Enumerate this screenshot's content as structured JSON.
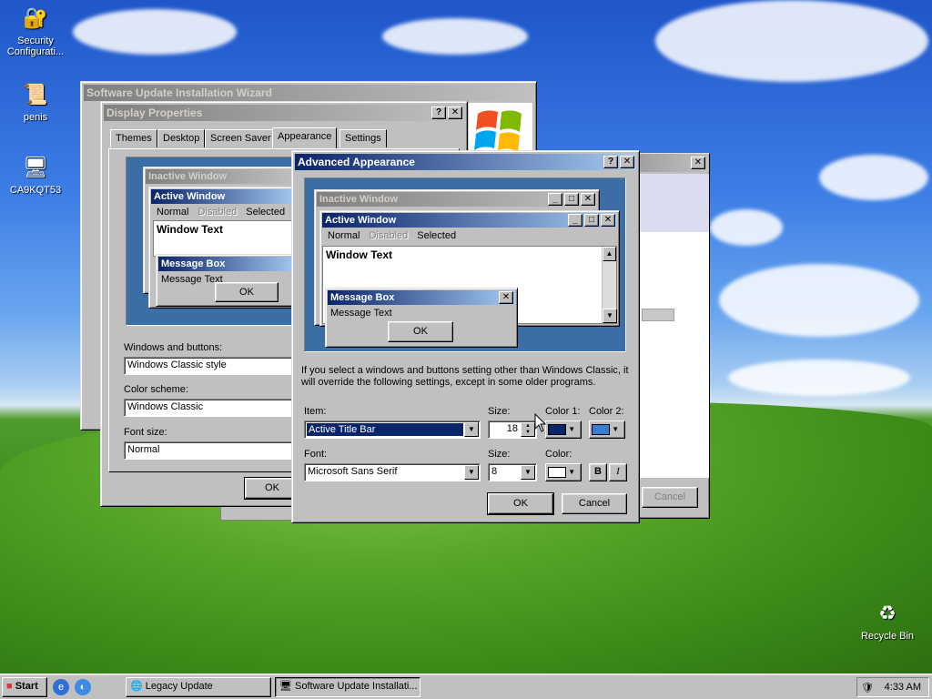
{
  "desktop": {
    "icons": [
      {
        "label": "Security Configurati...",
        "icon": "security-config-icon"
      },
      {
        "label": "penis",
        "icon": "certificate-icon"
      },
      {
        "label": "CA9KQT53",
        "icon": "computer-icon"
      },
      {
        "label": "Recycle Bin",
        "icon": "recycle-bin-icon"
      }
    ]
  },
  "wizard": {
    "title": "Software Update Installation Wizard",
    "close": "✕",
    "cancel_label": "Cancel"
  },
  "display_properties": {
    "title": "Display Properties",
    "help": "?",
    "close": "✕",
    "tabs": [
      "Themes",
      "Desktop",
      "Screen Saver",
      "Appearance",
      "Settings"
    ],
    "selected_tab": "Appearance",
    "preview": {
      "inactive_title": "Inactive Window",
      "active_title": "Active Window",
      "menu": [
        "Normal",
        "Disabled",
        "Selected"
      ],
      "window_text": "Window Text",
      "msgbox_title": "Message Box",
      "msgbox_text": "Message Text",
      "ok": "OK"
    },
    "windows_buttons_label": "Windows and buttons:",
    "windows_buttons_value": "Windows Classic style",
    "color_scheme_label": "Color scheme:",
    "color_scheme_value": "Windows Classic",
    "font_size_label": "Font size:",
    "font_size_value": "Normal",
    "ok_label": "OK"
  },
  "advanced": {
    "title": "Advanced Appearance",
    "help": "?",
    "close": "✕",
    "preview": {
      "inactive_title": "Inactive Window",
      "active_title": "Active Window",
      "menu": [
        "Normal",
        "Disabled",
        "Selected"
      ],
      "window_text": "Window Text",
      "msgbox_title": "Message Box",
      "msgbox_text": "Message Text",
      "ok": "OK"
    },
    "info_text": "If you select a windows and buttons setting other than Windows Classic, it will override the following settings, except in some older programs.",
    "item_label": "Item:",
    "item_value": "Active Title Bar",
    "size_label": "Size:",
    "size_value": "18",
    "color1_label": "Color 1:",
    "color2_label": "Color 2:",
    "font_label": "Font:",
    "font_value": "Microsoft Sans Serif",
    "font_size_label": "Size:",
    "font_size_value": "8",
    "font_color_label": "Color:",
    "bold": "B",
    "italic": "I",
    "ok_label": "OK",
    "cancel_label": "Cancel",
    "colors": {
      "color1": "#0a246a",
      "color2": "#3a7bd5",
      "font_color": "#ffffff"
    }
  },
  "taskbar": {
    "start": "Start",
    "items": [
      "Legacy Update",
      "Software Update Installati..."
    ],
    "clock": "4:33 AM"
  }
}
